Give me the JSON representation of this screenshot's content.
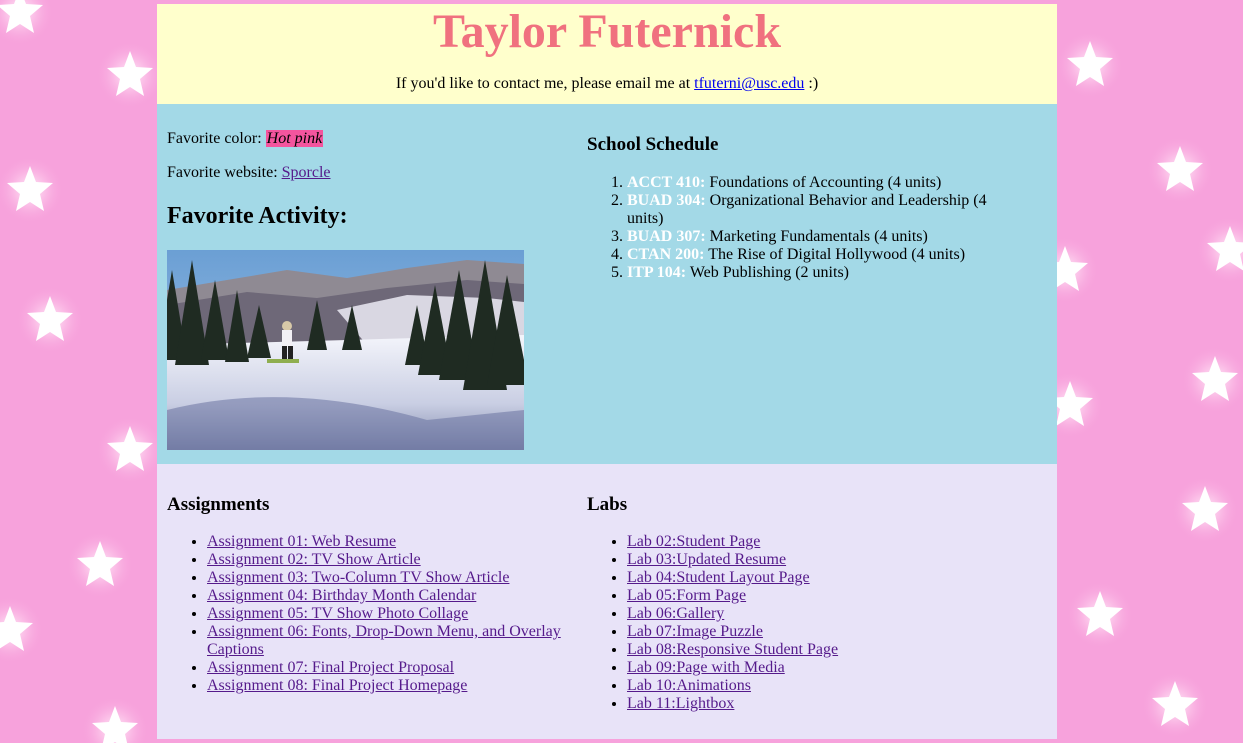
{
  "header": {
    "name": "Taylor Futernick",
    "contact_text": "If you'd like to contact me, please email me at ",
    "email": "tfuterni@usc.edu",
    "contact_suffix": " :)"
  },
  "favorites": {
    "color_label": "Favorite color: ",
    "color_value": "Hot pink",
    "website_label": "Favorite website: ",
    "website_value": "Sporcle",
    "activity_title": "Favorite Activity:"
  },
  "schedule": {
    "title": "School Schedule",
    "courses": [
      {
        "code": "ACCT 410:",
        "name": " Foundations of Accounting (4 units)"
      },
      {
        "code": "BUAD 304:",
        "name": " Organizational Behavior and Leadership (4 units)"
      },
      {
        "code": "BUAD 307:",
        "name": " Marketing Fundamentals (4 units)"
      },
      {
        "code": "CTAN 200:",
        "name": " The Rise of Digital Hollywood (4 units)"
      },
      {
        "code": "ITP 104:",
        "name": " Web Publishing (2 units)"
      }
    ]
  },
  "assignments": {
    "title": "Assignments",
    "items": [
      "Assignment 01: Web Resume",
      "Assignment 02: TV Show Article",
      "Assignment 03: Two-Column TV Show Article",
      "Assignment 04: Birthday Month Calendar",
      "Assignment 05: TV Show Photo Collage",
      "Assignment 06: Fonts, Drop-Down Menu, and Overlay Captions",
      "Assignment 07: Final Project Proposal",
      "Assignment 08: Final Project Homepage"
    ]
  },
  "labs": {
    "title": "Labs",
    "items": [
      "Lab 02:Student Page",
      "Lab 03:Updated Resume",
      "Lab 04:Student Layout Page",
      "Lab 05:Form Page",
      "Lab 06:Gallery",
      "Lab 07:Image Puzzle",
      "Lab 08:Responsive Student Page",
      "Lab 09:Page with Media",
      "Lab 10:Animations",
      "Lab 11:Lightbox"
    ]
  },
  "colors": {
    "background_pink": "#f7a2dc",
    "header_bg": "#ffffcc",
    "title_color": "#f0717f",
    "middle_bg": "#a3d9e7",
    "bottom_bg": "#e8e3f8",
    "hot_pink_highlight": "#f4559e"
  },
  "icons": {
    "background_pattern": "star-icon",
    "photo": "snowboarding-photo"
  }
}
